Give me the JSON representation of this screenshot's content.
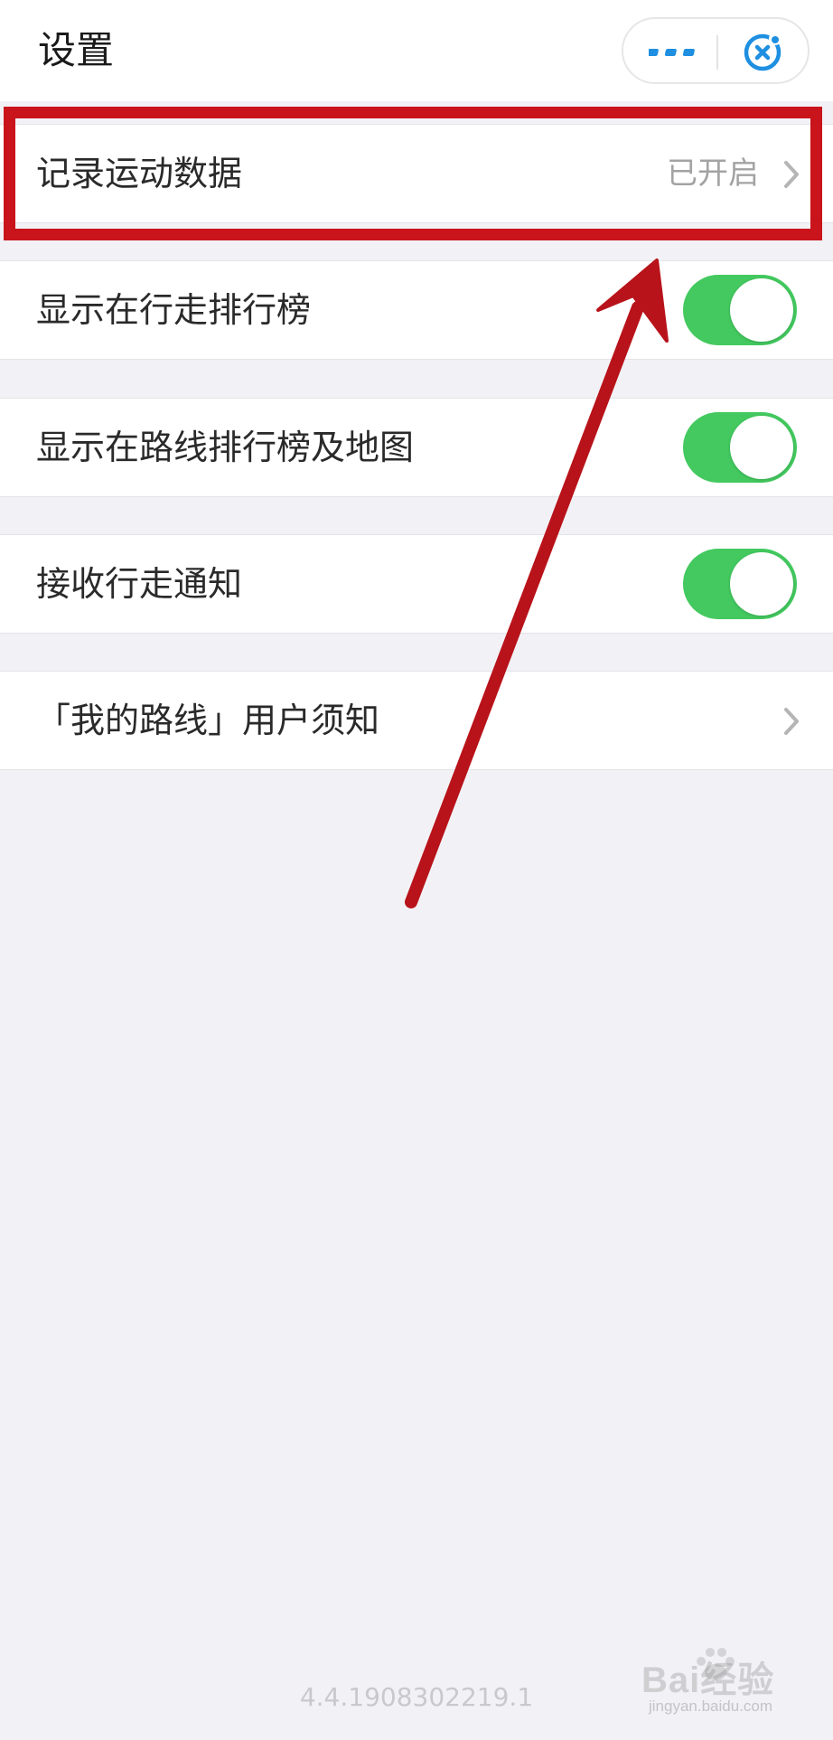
{
  "header": {
    "title": "设置",
    "capsule": {
      "more_icon": "more-dots-icon",
      "close_icon": "close-circle-icon"
    }
  },
  "settings": [
    {
      "label": "记录运动数据",
      "value": "已开启",
      "type": "link"
    },
    {
      "label": "显示在行走排行榜",
      "type": "toggle",
      "on": true
    },
    {
      "label": "显示在路线排行榜及地图",
      "type": "toggle",
      "on": true
    },
    {
      "label": "接收行走通知",
      "type": "toggle",
      "on": true
    },
    {
      "label": "「我的路线」用户须知",
      "type": "link"
    }
  ],
  "footer": {
    "version": "4.4.1908302219.1"
  },
  "annotation": {
    "highlight_color": "#c8141a",
    "highlighted_item": "记录运动数据"
  },
  "watermark": {
    "line1": "Bai经验",
    "line2": "jingyan.baidu.com"
  },
  "colors": {
    "toggle_on": "#43c95f",
    "accent_blue": "#1e8fe1",
    "background": "#f2f2f6"
  }
}
